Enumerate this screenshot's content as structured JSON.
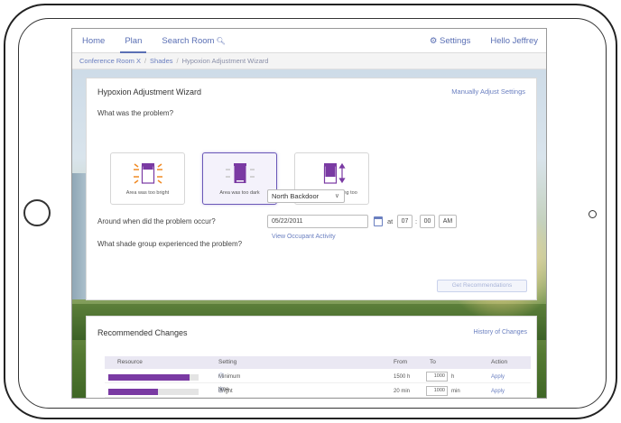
{
  "nav": {
    "items": [
      "Home",
      "Plan",
      "Search Room"
    ],
    "active_index": 1,
    "settings_label": "Settings",
    "greeting": "Hello Jeffrey"
  },
  "breadcrumb": [
    "Conference Room X",
    "Shades",
    "Hypoxion Adjustment Wizard"
  ],
  "wizard": {
    "title": "Hypoxion Adjustment Wizard",
    "manual_link": "Manually Adjust Settings",
    "question_problem": "What was the problem?",
    "options": [
      {
        "label": "Area was too bright"
      },
      {
        "label": "Area was too dark"
      },
      {
        "label": "Shades are moving too frequently"
      }
    ],
    "selected_option": 1,
    "question_group": "What shade group experienced the problem?",
    "group_value": "North Backdoor",
    "question_time": "Around when did the problem occur?",
    "date_value": "05/22/2011",
    "at_label": "at",
    "hour": "07",
    "minute": "00",
    "ampm": "AM",
    "occupant_link": "View Occupant Activity",
    "recommend_button": "Get Recommendations"
  },
  "changes": {
    "title": "Recommended Changes",
    "history_link": "History of Changes",
    "columns": [
      "Resource",
      "Setting",
      "From",
      "To",
      "Action"
    ],
    "rows": [
      {
        "level": 0.9,
        "setting": "Minimum time between shade movements",
        "from": "1500 h",
        "to": "1000",
        "unit": "h",
        "action": "Apply"
      },
      {
        "level": 0.55,
        "setting": "Bright override position",
        "from": "20 min",
        "to": "1000",
        "unit": "min",
        "action": "Apply"
      }
    ],
    "accent": "#7a3aa3"
  },
  "colors": {
    "link": "#5a6fb4",
    "selected": "#6a58b8",
    "icon_purple": "#7a3aa3",
    "icon_orange": "#f08a24"
  }
}
